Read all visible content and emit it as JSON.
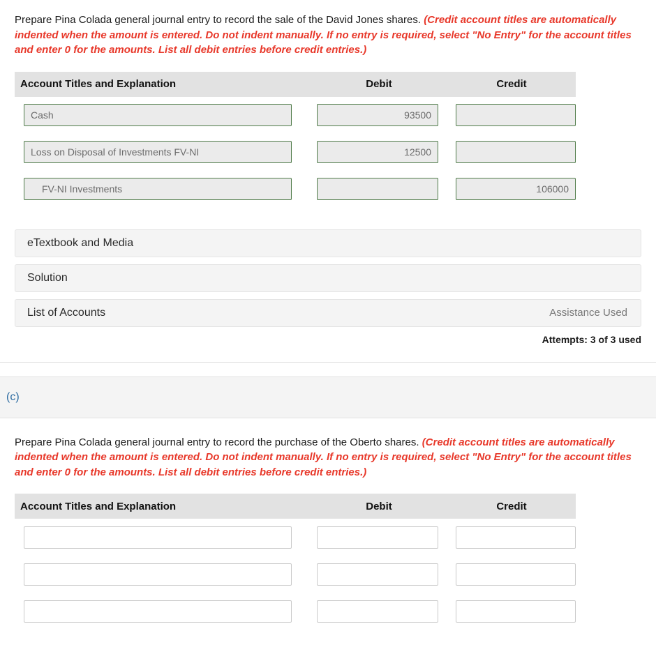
{
  "part_b": {
    "prompt_main": "Prepare Pina Colada general journal entry to record the sale of the David Jones shares.",
    "prompt_note": "(Credit account titles are automatically indented when the amount is entered. Do not indent manually. If no entry is required, select \"No Entry\" for the account titles and enter 0 for the amounts. List all debit entries before credit entries.)",
    "table": {
      "headers": {
        "account": "Account Titles and Explanation",
        "debit": "Debit",
        "credit": "Credit"
      },
      "rows": [
        {
          "account": "Cash",
          "debit": "93500",
          "credit": "",
          "indented": false
        },
        {
          "account": "Loss on Disposal of Investments FV-NI",
          "debit": "12500",
          "credit": "",
          "indented": false
        },
        {
          "account": "FV-NI Investments",
          "debit": "",
          "credit": "106000",
          "indented": true
        }
      ]
    },
    "accordions": [
      {
        "label": "eTextbook and Media",
        "right": ""
      },
      {
        "label": "Solution",
        "right": ""
      },
      {
        "label": "List of Accounts",
        "right": "Assistance Used"
      }
    ],
    "attempts": "Attempts: 3 of 3 used"
  },
  "part_c": {
    "label": "(c)",
    "prompt_main": "Prepare Pina Colada general journal entry to record the purchase of the Oberto shares.",
    "prompt_note": "(Credit account titles are automatically indented when the amount is entered. Do not indent manually. If no entry is required, select \"No Entry\" for the account titles and enter 0 for the amounts. List all debit entries before credit entries.)",
    "table": {
      "headers": {
        "account": "Account Titles and Explanation",
        "debit": "Debit",
        "credit": "Credit"
      },
      "rows": [
        {
          "account": "",
          "debit": "",
          "credit": ""
        },
        {
          "account": "",
          "debit": "",
          "credit": ""
        },
        {
          "account": "",
          "debit": "",
          "credit": ""
        }
      ]
    }
  },
  "colors": {
    "note_red": "#e8382a",
    "field_border_filled": "#4d7a47",
    "field_fill_filled": "#ebebeb",
    "field_border_blank": "#c9c9c9",
    "header_bg": "#e2e2e2",
    "accordion_bg": "#f4f4f4",
    "part_label_blue": "#2d6ca2"
  }
}
